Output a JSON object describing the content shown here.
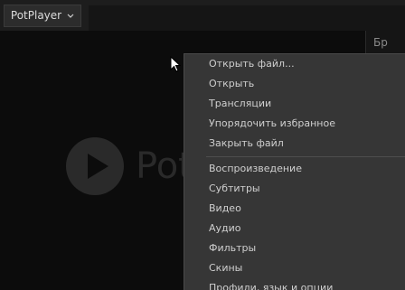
{
  "app": {
    "menu_label": "PotPlayer",
    "watermark_text": "Pot"
  },
  "right_panel": {
    "tab_label": "Бр"
  },
  "context_menu": {
    "group1": [
      "Открыть файл...",
      "Открыть",
      "Трансляции",
      "Упорядочить избранное",
      "Закрыть файл"
    ],
    "group2": [
      "Воспроизведение",
      "Субтитры",
      "Видео",
      "Аудио",
      "Фильтры",
      "Скины",
      "Профили, язык и опции"
    ]
  },
  "colors": {
    "background": "#0c0c0c",
    "menu_bg": "#363636",
    "menu_text": "#cfcfcf"
  }
}
